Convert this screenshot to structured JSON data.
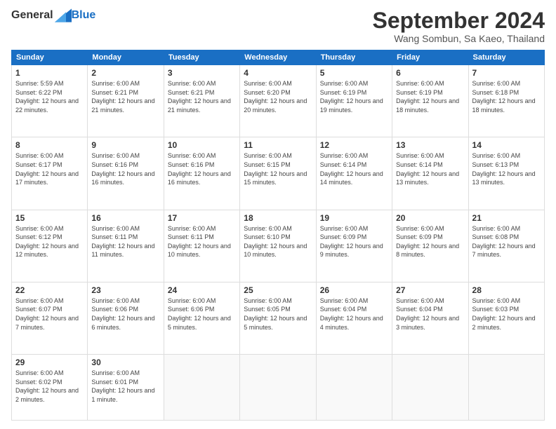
{
  "logo": {
    "general": "General",
    "blue": "Blue"
  },
  "header": {
    "month": "September 2024",
    "location": "Wang Sombun, Sa Kaeo, Thailand"
  },
  "weekdays": [
    "Sunday",
    "Monday",
    "Tuesday",
    "Wednesday",
    "Thursday",
    "Friday",
    "Saturday"
  ],
  "weeks": [
    [
      {
        "day": "1",
        "sunrise": "5:59 AM",
        "sunset": "6:22 PM",
        "daylight": "12 hours and 22 minutes."
      },
      {
        "day": "2",
        "sunrise": "6:00 AM",
        "sunset": "6:21 PM",
        "daylight": "12 hours and 21 minutes."
      },
      {
        "day": "3",
        "sunrise": "6:00 AM",
        "sunset": "6:21 PM",
        "daylight": "12 hours and 21 minutes."
      },
      {
        "day": "4",
        "sunrise": "6:00 AM",
        "sunset": "6:20 PM",
        "daylight": "12 hours and 20 minutes."
      },
      {
        "day": "5",
        "sunrise": "6:00 AM",
        "sunset": "6:19 PM",
        "daylight": "12 hours and 19 minutes."
      },
      {
        "day": "6",
        "sunrise": "6:00 AM",
        "sunset": "6:19 PM",
        "daylight": "12 hours and 18 minutes."
      },
      {
        "day": "7",
        "sunrise": "6:00 AM",
        "sunset": "6:18 PM",
        "daylight": "12 hours and 18 minutes."
      }
    ],
    [
      {
        "day": "8",
        "sunrise": "6:00 AM",
        "sunset": "6:17 PM",
        "daylight": "12 hours and 17 minutes."
      },
      {
        "day": "9",
        "sunrise": "6:00 AM",
        "sunset": "6:16 PM",
        "daylight": "12 hours and 16 minutes."
      },
      {
        "day": "10",
        "sunrise": "6:00 AM",
        "sunset": "6:16 PM",
        "daylight": "12 hours and 16 minutes."
      },
      {
        "day": "11",
        "sunrise": "6:00 AM",
        "sunset": "6:15 PM",
        "daylight": "12 hours and 15 minutes."
      },
      {
        "day": "12",
        "sunrise": "6:00 AM",
        "sunset": "6:14 PM",
        "daylight": "12 hours and 14 minutes."
      },
      {
        "day": "13",
        "sunrise": "6:00 AM",
        "sunset": "6:14 PM",
        "daylight": "12 hours and 13 minutes."
      },
      {
        "day": "14",
        "sunrise": "6:00 AM",
        "sunset": "6:13 PM",
        "daylight": "12 hours and 13 minutes."
      }
    ],
    [
      {
        "day": "15",
        "sunrise": "6:00 AM",
        "sunset": "6:12 PM",
        "daylight": "12 hours and 12 minutes."
      },
      {
        "day": "16",
        "sunrise": "6:00 AM",
        "sunset": "6:11 PM",
        "daylight": "12 hours and 11 minutes."
      },
      {
        "day": "17",
        "sunrise": "6:00 AM",
        "sunset": "6:11 PM",
        "daylight": "12 hours and 10 minutes."
      },
      {
        "day": "18",
        "sunrise": "6:00 AM",
        "sunset": "6:10 PM",
        "daylight": "12 hours and 10 minutes."
      },
      {
        "day": "19",
        "sunrise": "6:00 AM",
        "sunset": "6:09 PM",
        "daylight": "12 hours and 9 minutes."
      },
      {
        "day": "20",
        "sunrise": "6:00 AM",
        "sunset": "6:09 PM",
        "daylight": "12 hours and 8 minutes."
      },
      {
        "day": "21",
        "sunrise": "6:00 AM",
        "sunset": "6:08 PM",
        "daylight": "12 hours and 7 minutes."
      }
    ],
    [
      {
        "day": "22",
        "sunrise": "6:00 AM",
        "sunset": "6:07 PM",
        "daylight": "12 hours and 7 minutes."
      },
      {
        "day": "23",
        "sunrise": "6:00 AM",
        "sunset": "6:06 PM",
        "daylight": "12 hours and 6 minutes."
      },
      {
        "day": "24",
        "sunrise": "6:00 AM",
        "sunset": "6:06 PM",
        "daylight": "12 hours and 5 minutes."
      },
      {
        "day": "25",
        "sunrise": "6:00 AM",
        "sunset": "6:05 PM",
        "daylight": "12 hours and 5 minutes."
      },
      {
        "day": "26",
        "sunrise": "6:00 AM",
        "sunset": "6:04 PM",
        "daylight": "12 hours and 4 minutes."
      },
      {
        "day": "27",
        "sunrise": "6:00 AM",
        "sunset": "6:04 PM",
        "daylight": "12 hours and 3 minutes."
      },
      {
        "day": "28",
        "sunrise": "6:00 AM",
        "sunset": "6:03 PM",
        "daylight": "12 hours and 2 minutes."
      }
    ],
    [
      {
        "day": "29",
        "sunrise": "6:00 AM",
        "sunset": "6:02 PM",
        "daylight": "12 hours and 2 minutes."
      },
      {
        "day": "30",
        "sunrise": "6:00 AM",
        "sunset": "6:01 PM",
        "daylight": "12 hours and 1 minute."
      },
      null,
      null,
      null,
      null,
      null
    ]
  ]
}
